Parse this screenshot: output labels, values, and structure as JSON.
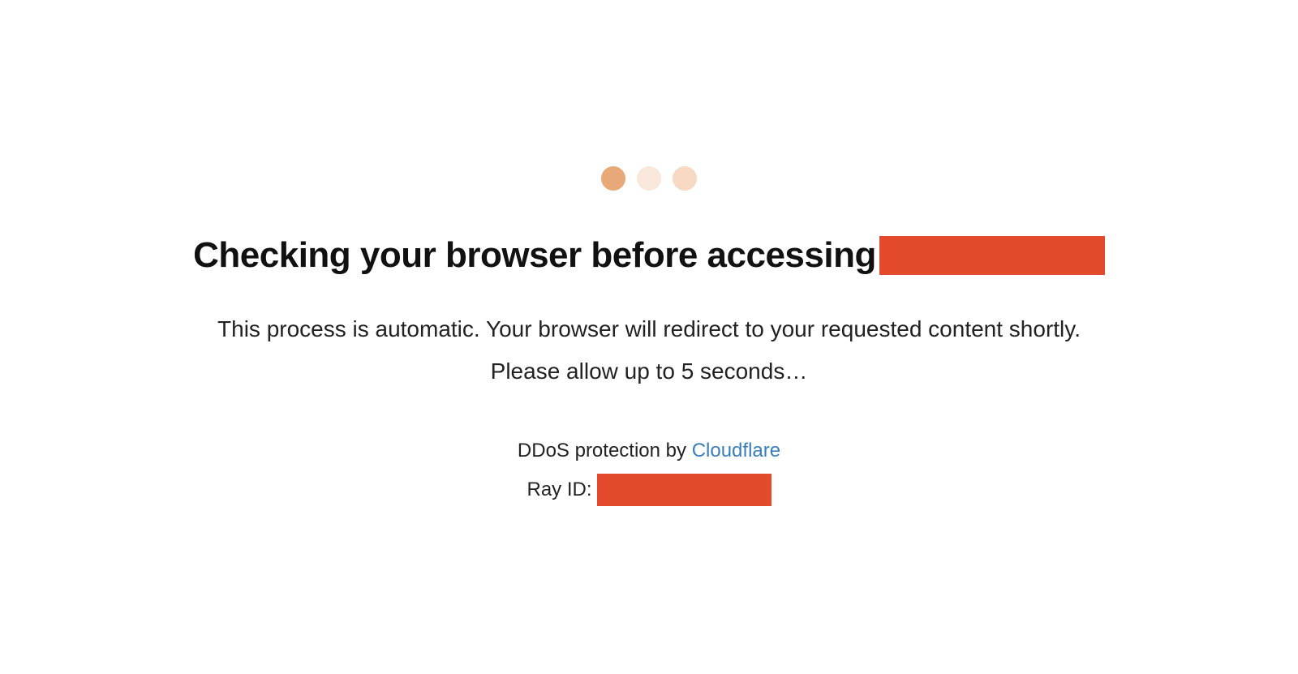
{
  "colors": {
    "redaction": "#e34a2b",
    "link": "#3a7fb8",
    "dot_primary": "#e8a878",
    "dot_faded1": "#f8e7da",
    "dot_faded2": "#f7d9c4"
  },
  "heading": {
    "text": "Checking your browser before accessing"
  },
  "description": {
    "line1": "This process is automatic. Your browser will redirect to your requested content shortly.",
    "line2": "Please allow up to 5 seconds…"
  },
  "footer": {
    "protection_prefix": "DDoS protection by ",
    "protection_link_label": "Cloudflare",
    "ray_id_label": "Ray ID: "
  }
}
